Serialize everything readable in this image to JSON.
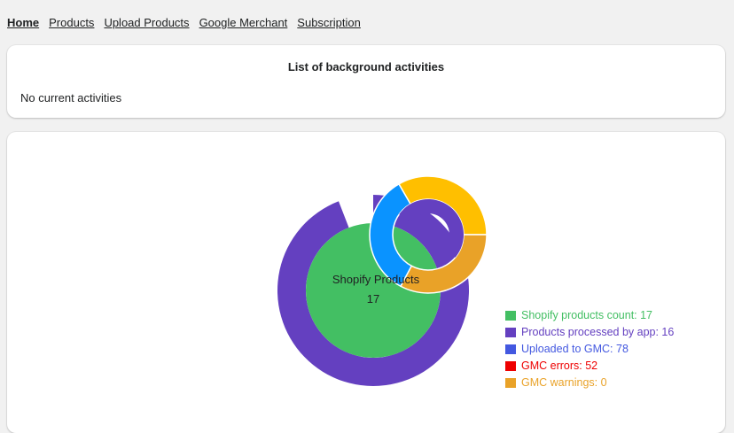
{
  "nav": {
    "items": [
      {
        "label": "Home",
        "active": true
      },
      {
        "label": "Products"
      },
      {
        "label": "Upload Products"
      },
      {
        "label": "Google Merchant"
      },
      {
        "label": "Subscription"
      }
    ]
  },
  "activities": {
    "title": "List of background activities",
    "empty_text": "No current activities"
  },
  "chart_data": {
    "type": "pie",
    "center_label": "Shopify Products",
    "center_value": "17",
    "series": [
      {
        "name": "Shopify products count",
        "value": 17,
        "color": "#43bf63"
      },
      {
        "name": "Products processed by app",
        "value": 16,
        "color": "#6440c0"
      },
      {
        "name": "Uploaded to GMC",
        "value": 78,
        "color": "#4358e0"
      },
      {
        "name": "GMC errors",
        "value": 52,
        "color": "#ee0000"
      },
      {
        "name": "GMC warnings",
        "value": 0,
        "color": "#e9a228"
      }
    ],
    "legend": {
      "position": "bottom-right",
      "items": [
        "Shopify products count: 17",
        "Products processed by app: 16",
        "Uploaded to GMC: 78",
        "GMC errors: 52",
        "GMC warnings: 0"
      ]
    },
    "overlay_colors": [
      "#ffbf00",
      "#e9a228",
      "#0a93ff"
    ]
  }
}
